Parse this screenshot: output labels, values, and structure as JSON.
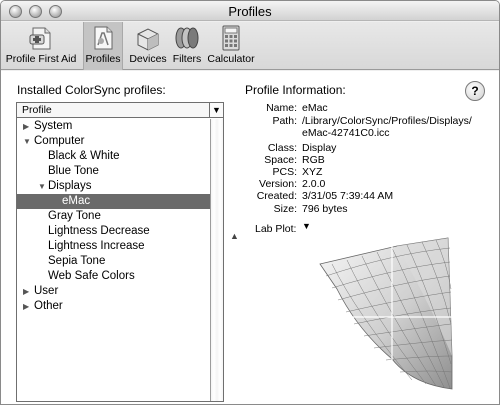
{
  "window": {
    "title": "Profiles"
  },
  "toolbar": {
    "items": [
      {
        "label": "Profile First Aid",
        "icon": "first-aid-icon"
      },
      {
        "label": "Profiles",
        "icon": "profiles-icon",
        "active": true
      },
      {
        "label": "Devices",
        "icon": "devices-icon"
      },
      {
        "label": "Filters",
        "icon": "filters-icon"
      },
      {
        "label": "Calculator",
        "icon": "calculator-icon"
      }
    ]
  },
  "left": {
    "heading": "Installed ColorSync profiles:",
    "column_header": "Profile",
    "tree": [
      {
        "label": "System",
        "level": 0,
        "expander": "collapsed"
      },
      {
        "label": "Computer",
        "level": 0,
        "expander": "expanded"
      },
      {
        "label": "Black & White",
        "level": 1
      },
      {
        "label": "Blue Tone",
        "level": 1
      },
      {
        "label": "Displays",
        "level": 1,
        "expander": "expanded"
      },
      {
        "label": "eMac",
        "level": 2,
        "selected": true
      },
      {
        "label": "Gray Tone",
        "level": 1
      },
      {
        "label": "Lightness Decrease",
        "level": 1
      },
      {
        "label": "Lightness Increase",
        "level": 1
      },
      {
        "label": "Sepia Tone",
        "level": 1
      },
      {
        "label": "Web Safe Colors",
        "level": 1
      },
      {
        "label": "User",
        "level": 0,
        "expander": "collapsed"
      },
      {
        "label": "Other",
        "level": 0,
        "expander": "collapsed"
      }
    ]
  },
  "right": {
    "heading": "Profile Information:",
    "help_label": "?",
    "fields": [
      {
        "key": "Name:",
        "value": "eMac"
      },
      {
        "key": "Path:",
        "value": "/Library/ColorSync/Profiles/Displays/",
        "value2": "eMac-42741C0.icc"
      },
      {
        "key": "Class:",
        "value": "Display"
      },
      {
        "key": "Space:",
        "value": "RGB"
      },
      {
        "key": "PCS:",
        "value": "XYZ"
      },
      {
        "key": "Version:",
        "value": "2.0.0"
      },
      {
        "key": "Created:",
        "value": "3/31/05 7:39:44 AM"
      },
      {
        "key": "Size:",
        "value": "796 bytes"
      }
    ],
    "plot_label": "Lab Plot:"
  },
  "colors": {
    "selection": "#6a6a6a",
    "window_bg": "#efefef"
  }
}
